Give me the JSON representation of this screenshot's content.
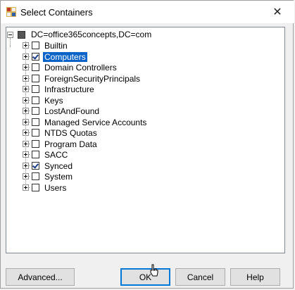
{
  "window": {
    "title": "Select Containers",
    "close_glyph": "✕"
  },
  "tree": {
    "root": {
      "label": "DC=office365concepts,DC=com"
    },
    "items": [
      {
        "label": "Builtin",
        "checked": false,
        "selected": false
      },
      {
        "label": "Computers",
        "checked": true,
        "selected": true
      },
      {
        "label": "Domain Controllers",
        "checked": false,
        "selected": false
      },
      {
        "label": "ForeignSecurityPrincipals",
        "checked": false,
        "selected": false
      },
      {
        "label": "Infrastructure",
        "checked": false,
        "selected": false
      },
      {
        "label": "Keys",
        "checked": false,
        "selected": false
      },
      {
        "label": "LostAndFound",
        "checked": false,
        "selected": false
      },
      {
        "label": "Managed Service Accounts",
        "checked": false,
        "selected": false
      },
      {
        "label": "NTDS Quotas",
        "checked": false,
        "selected": false
      },
      {
        "label": "Program Data",
        "checked": false,
        "selected": false
      },
      {
        "label": "SACC",
        "checked": false,
        "selected": false
      },
      {
        "label": "Synced",
        "checked": true,
        "selected": false
      },
      {
        "label": "System",
        "checked": false,
        "selected": false
      },
      {
        "label": "Users",
        "checked": false,
        "selected": false
      }
    ]
  },
  "buttons": {
    "advanced": "Advanced...",
    "ok": "OK",
    "cancel": "Cancel",
    "help": "Help"
  },
  "colors": {
    "selection": "#0a64c8",
    "default_button_border": "#0078d7"
  }
}
